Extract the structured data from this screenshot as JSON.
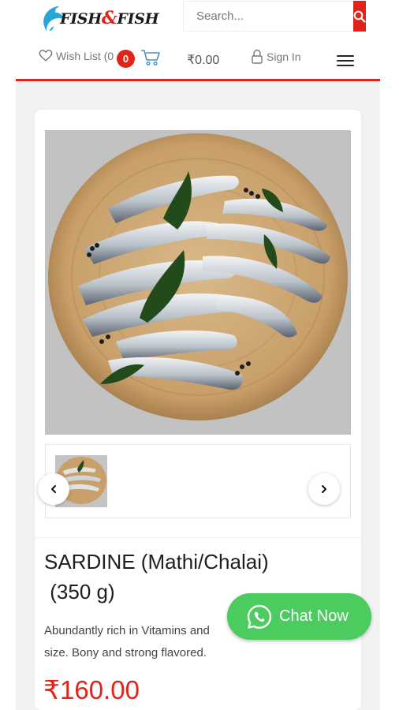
{
  "header": {
    "brand": {
      "part1": "FISH",
      "ampersand": "&",
      "part2": "FISH"
    },
    "search": {
      "placeholder": "Search...",
      "button_icon": "search-icon"
    },
    "wishlist": {
      "label": "Wish List (0",
      "icon": "heart-icon"
    },
    "cart": {
      "count": "0",
      "total": "₹0.00",
      "icon": "cart-icon"
    },
    "account": {
      "label": "Sign In",
      "icon": "lock-icon"
    },
    "menu_icon": "hamburger-icon",
    "accent_color": "#e2231a"
  },
  "product": {
    "image_subject": "sardines on wooden plate with curry leaves",
    "title_line1": "SARDINE (Mathi/Chalai)",
    "title_line2": "(350 g)",
    "description_line1": "Abundantly rich in Vitamins and",
    "description_line2": "size. Bony and strong flavored.",
    "price": "₹160.00",
    "price_color": "#e2231a",
    "gallery": {
      "prev_icon": "chevron-left-icon",
      "next_icon": "chevron-right-icon"
    }
  },
  "chat": {
    "label": "Chat Now",
    "icon": "whatsapp-icon",
    "color": "#4ccb5e"
  }
}
